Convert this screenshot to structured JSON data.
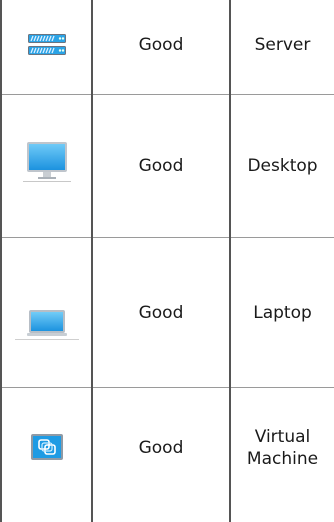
{
  "rows": [
    {
      "icon": "server-icon",
      "status": "Good",
      "type": "Server"
    },
    {
      "icon": "desktop-icon",
      "status": "Good",
      "type": "Desktop"
    },
    {
      "icon": "laptop-icon",
      "status": "Good",
      "type": "Laptop"
    },
    {
      "icon": "virtual-machine-icon",
      "status": "Good",
      "type": "Virtual\nMachine"
    }
  ],
  "colors": {
    "border": "#555555",
    "row_divider": "#9a9a9a",
    "icon_blue": "#2aa3e6"
  }
}
